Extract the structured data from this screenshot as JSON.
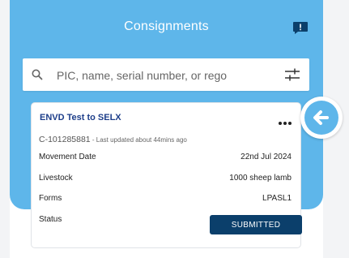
{
  "header": {
    "title": "Consignments",
    "chat_icon": "chat-alert-icon"
  },
  "search": {
    "placeholder": "PIC, name, serial number, or rego",
    "value": ""
  },
  "card": {
    "name": "ENVD Test to SELX",
    "id": "C-101285881",
    "updated": " - Last updated about 44mins ago",
    "rows": [
      {
        "label": "Movement Date",
        "value": "22nd Jul 2024"
      },
      {
        "label": "Livestock",
        "value": "1000 sheep lamb"
      },
      {
        "label": "Forms",
        "value": "LPASL1"
      }
    ],
    "status_label": "Status",
    "status_value": "SUBMITTED"
  },
  "colors": {
    "header_bg": "#5eb6ea",
    "title": "#1d3e8a",
    "button_bg": "#0b3f6b"
  }
}
